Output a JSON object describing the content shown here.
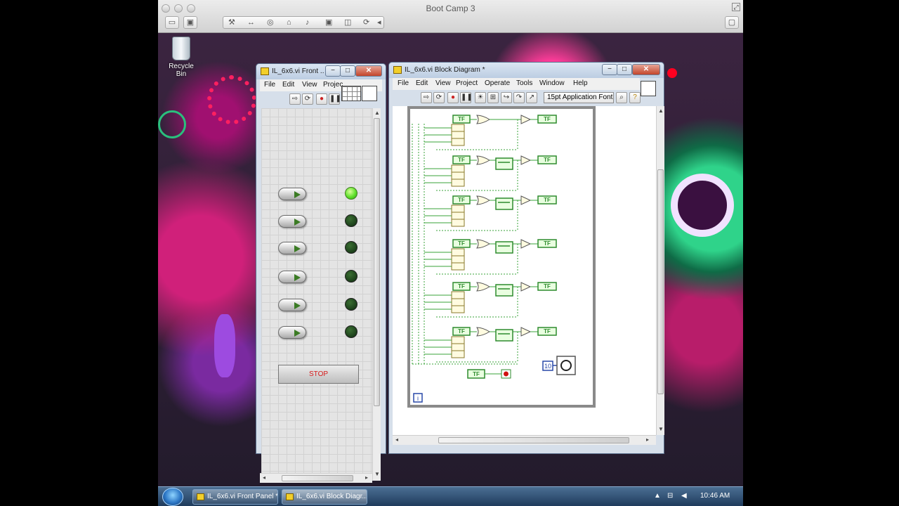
{
  "mac": {
    "title": "Boot Camp 3",
    "toolbar_icons": [
      "wrench-icon",
      "arrows-icon",
      "disk-icon",
      "lock-icon",
      "speaker-icon",
      "chip-icon",
      "trash-icon",
      "sync-icon",
      "chevron-left-icon"
    ]
  },
  "desktop": {
    "recycle_bin": "Recycle Bin"
  },
  "front_panel": {
    "title": "IL_6x6.vi Front ...",
    "menus": [
      "File",
      "Edit",
      "View",
      "Projec"
    ],
    "win_buttons": {
      "minimize": "−",
      "maximize": "□",
      "close": "✕"
    },
    "leds_on": [
      true,
      false,
      false,
      false,
      false,
      false
    ],
    "stop_label": "STOP"
  },
  "block_diagram": {
    "title": "IL_6x6.vi Block Diagram *",
    "menus": [
      "File",
      "Edit",
      "View",
      "Project",
      "Operate",
      "Tools",
      "Window",
      "Help"
    ],
    "font_selector": "15pt Application Font",
    "wait_constant": "10",
    "loop_iteration": "i",
    "bool_label": "TF"
  },
  "taskbar": {
    "buttons": [
      {
        "label": "IL_6x6.vi Front Panel *",
        "active": false
      },
      {
        "label": "IL_6x6.vi Block Diagr...",
        "active": true
      }
    ],
    "clock": "10:46 AM"
  }
}
